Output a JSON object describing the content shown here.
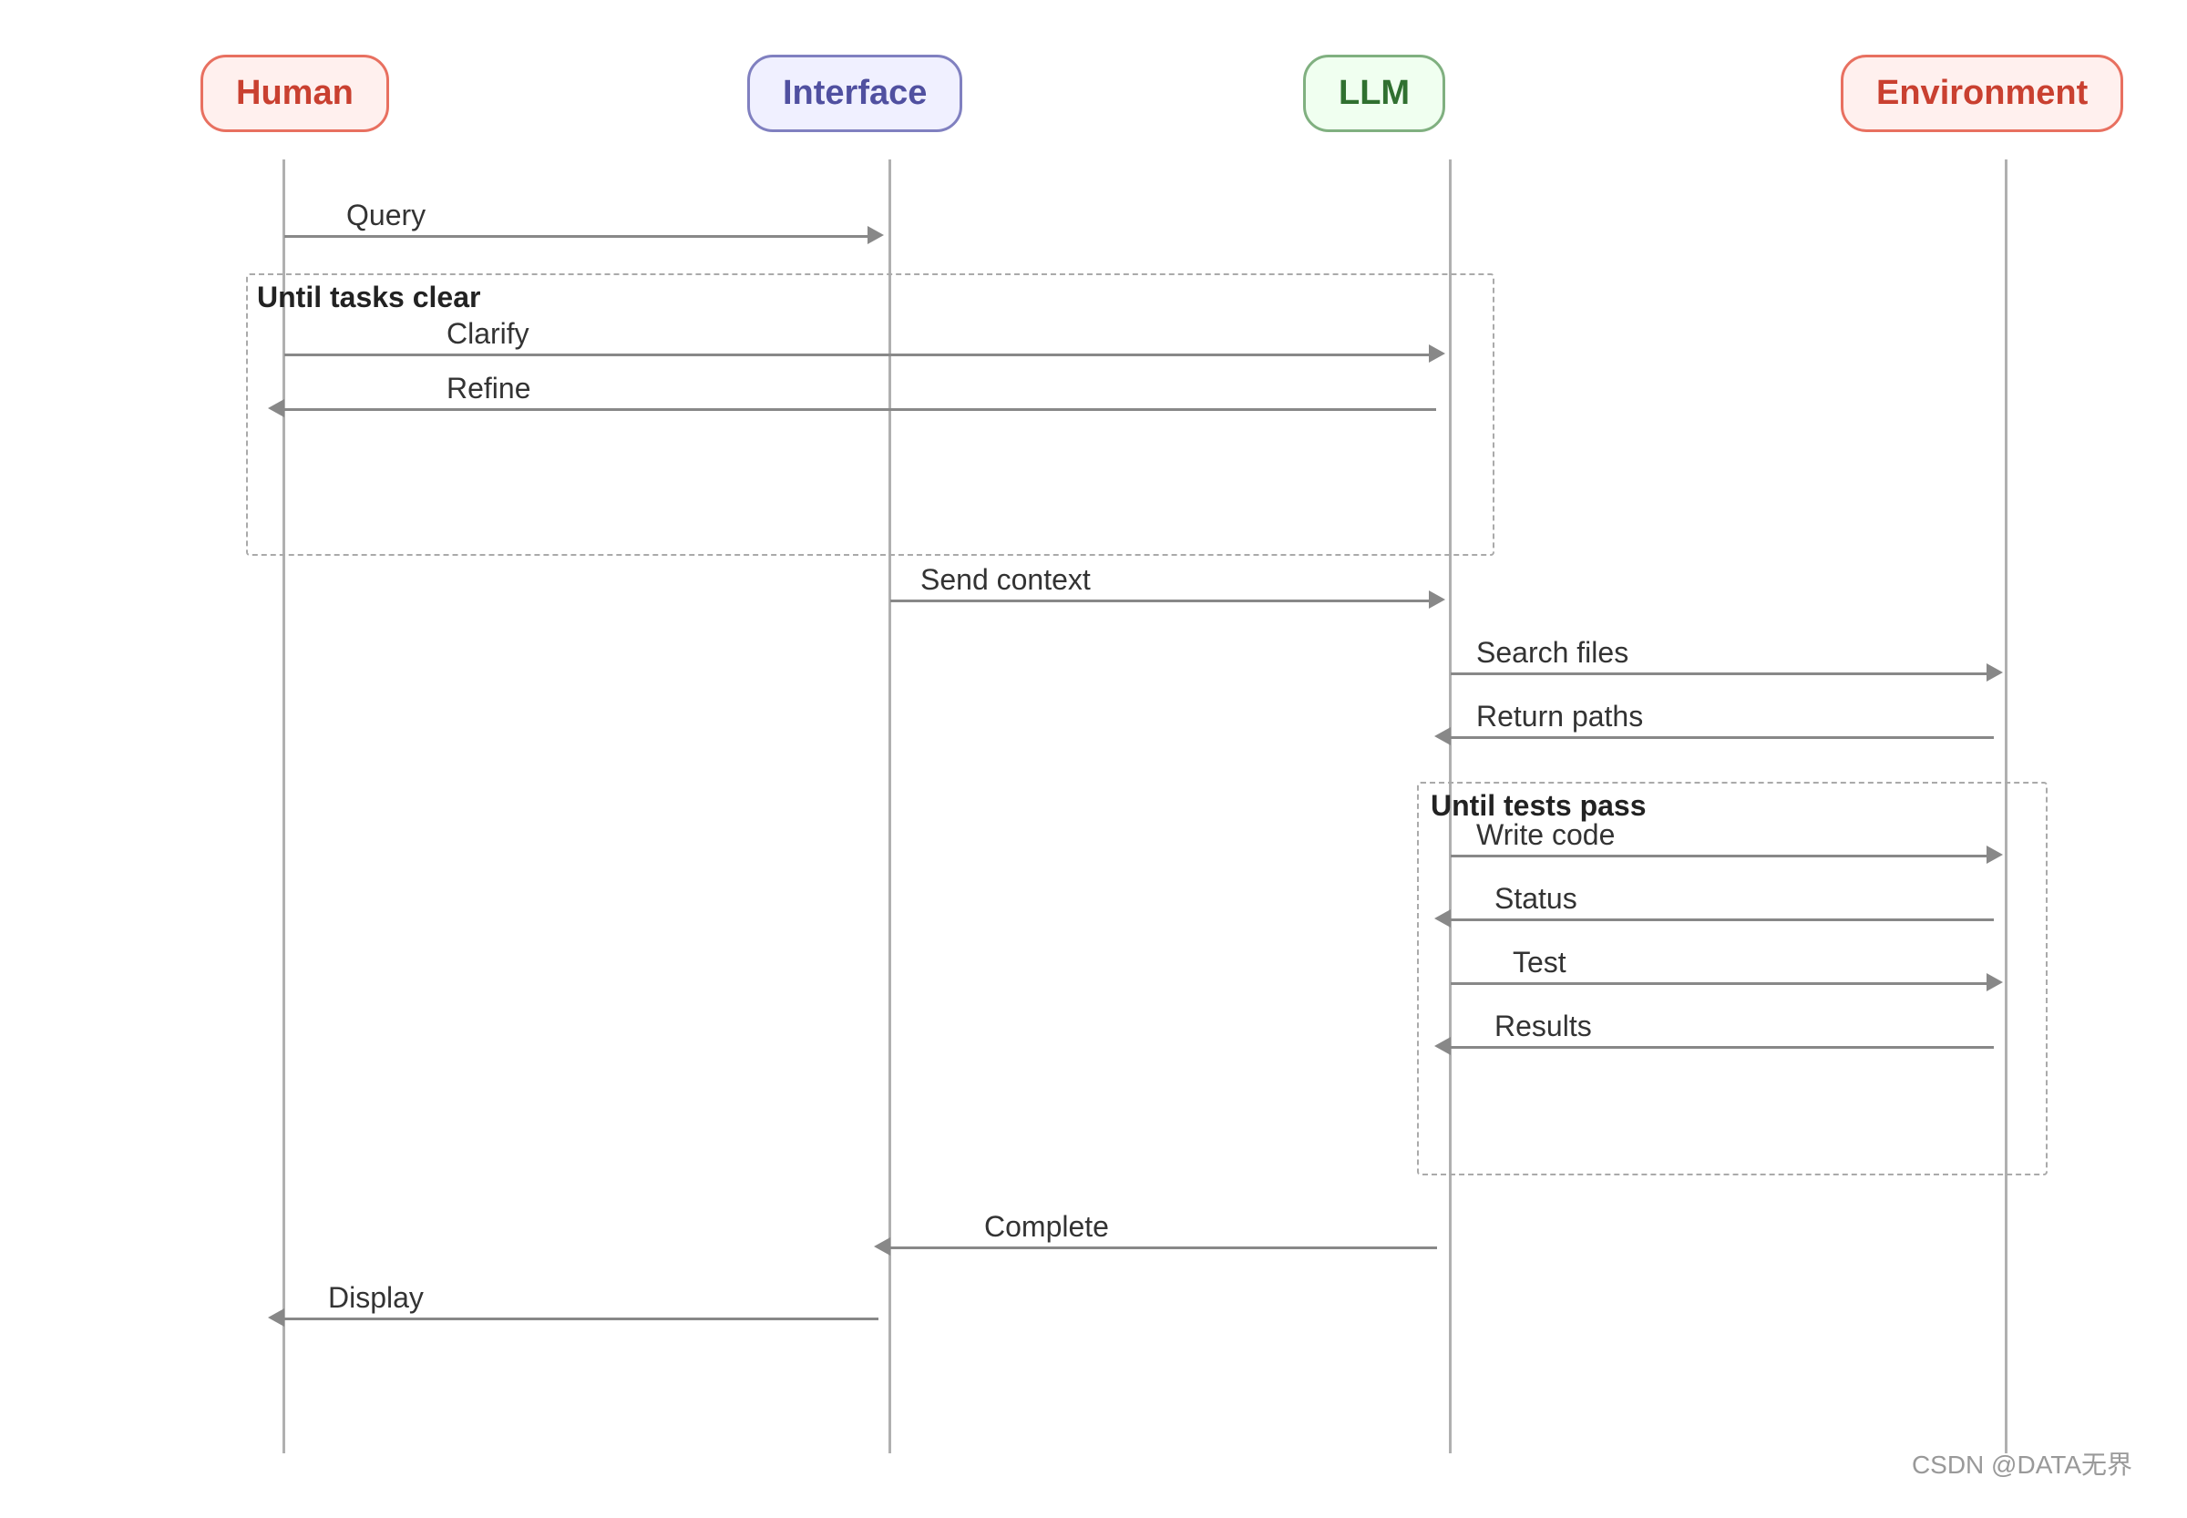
{
  "actors": {
    "human": {
      "label": "Human"
    },
    "interface": {
      "label": "Interface"
    },
    "llm": {
      "label": "LLM"
    },
    "environment": {
      "label": "Environment"
    }
  },
  "loops": {
    "until_tasks_clear": "Until tasks clear",
    "until_tests_pass": "Until tests pass"
  },
  "messages": [
    {
      "id": "query",
      "label": "Query",
      "direction": "right"
    },
    {
      "id": "clarify",
      "label": "Clarify",
      "direction": "right"
    },
    {
      "id": "refine",
      "label": "Refine",
      "direction": "left"
    },
    {
      "id": "send_context",
      "label": "Send context",
      "direction": "right"
    },
    {
      "id": "search_files",
      "label": "Search files",
      "direction": "right"
    },
    {
      "id": "return_paths",
      "label": "Return paths",
      "direction": "left"
    },
    {
      "id": "write_code",
      "label": "Write code",
      "direction": "right"
    },
    {
      "id": "status",
      "label": "Status",
      "direction": "left"
    },
    {
      "id": "test",
      "label": "Test",
      "direction": "right"
    },
    {
      "id": "results",
      "label": "Results",
      "direction": "left"
    },
    {
      "id": "complete",
      "label": "Complete",
      "direction": "left"
    },
    {
      "id": "display",
      "label": "Display",
      "direction": "left"
    }
  ],
  "watermark": "CSDN @DATA无界"
}
